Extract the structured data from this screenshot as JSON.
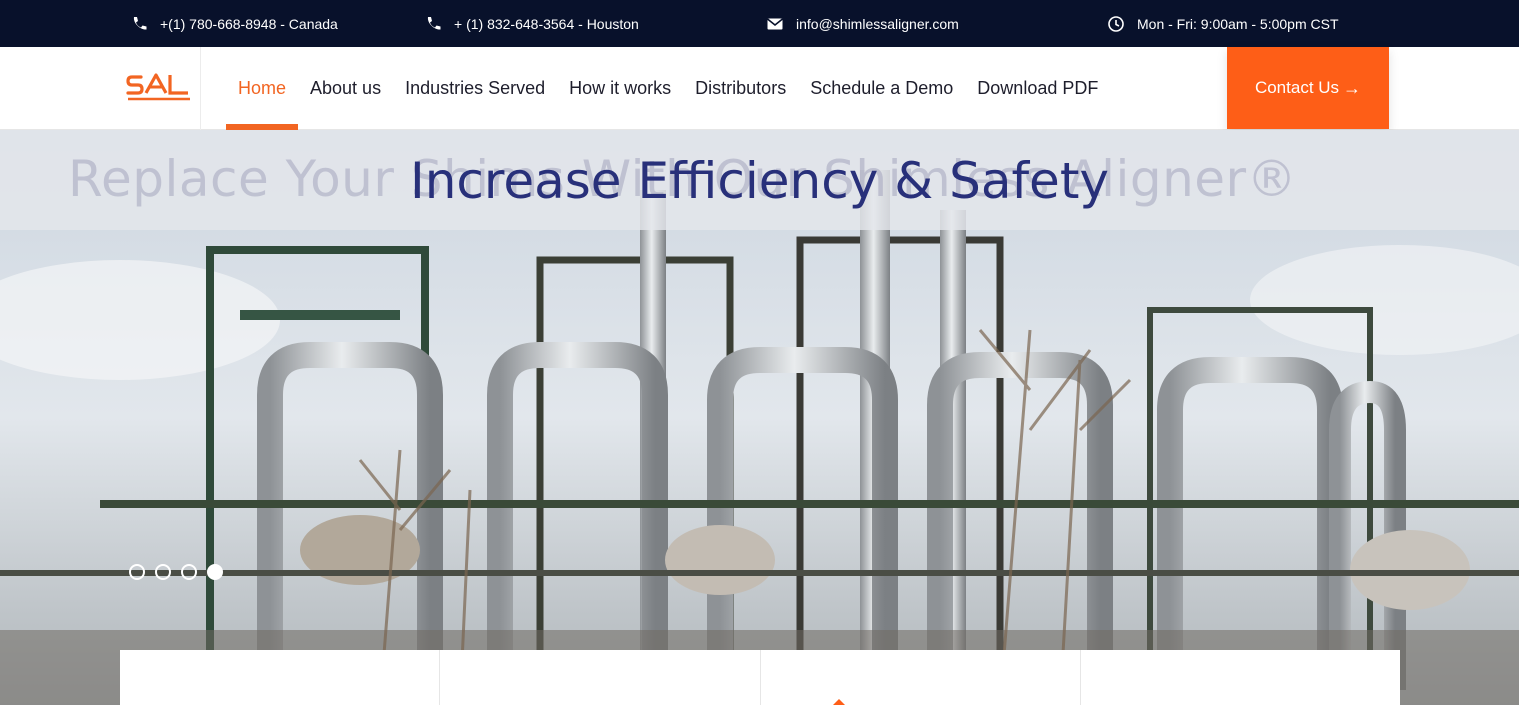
{
  "topbar": {
    "items": [
      {
        "icon": "phone-icon",
        "text": "+(1) 780-668-8948 - Canada"
      },
      {
        "icon": "phone-icon",
        "text": "+ (1) 832-648-3564 - Houston"
      },
      {
        "icon": "mail-icon",
        "text": "info@shimlessaligner.com"
      },
      {
        "icon": "clock-icon",
        "text": "Mon - Fri: 9:00am - 5:00pm CST"
      }
    ]
  },
  "header": {
    "logo_text": "SAL",
    "nav": [
      {
        "label": "Home",
        "active": true
      },
      {
        "label": "About us"
      },
      {
        "label": "Industries Served"
      },
      {
        "label": "How it works"
      },
      {
        "label": "Distributors"
      },
      {
        "label": "Schedule a Demo"
      },
      {
        "label": "Download PDF"
      }
    ],
    "cta_label": "Contact Us",
    "cta_arrow": "→"
  },
  "hero": {
    "headline": "Increase Efficiency & Safety",
    "ghost_text": "Replace Your Shims With Our Shimless Aligner®",
    "slides_total": 4,
    "active_slide": 4
  },
  "colors": {
    "topbar_bg": "#08112b",
    "accent": "#fe5e17",
    "nav_active": "#f26522",
    "headline": "#28307a"
  }
}
